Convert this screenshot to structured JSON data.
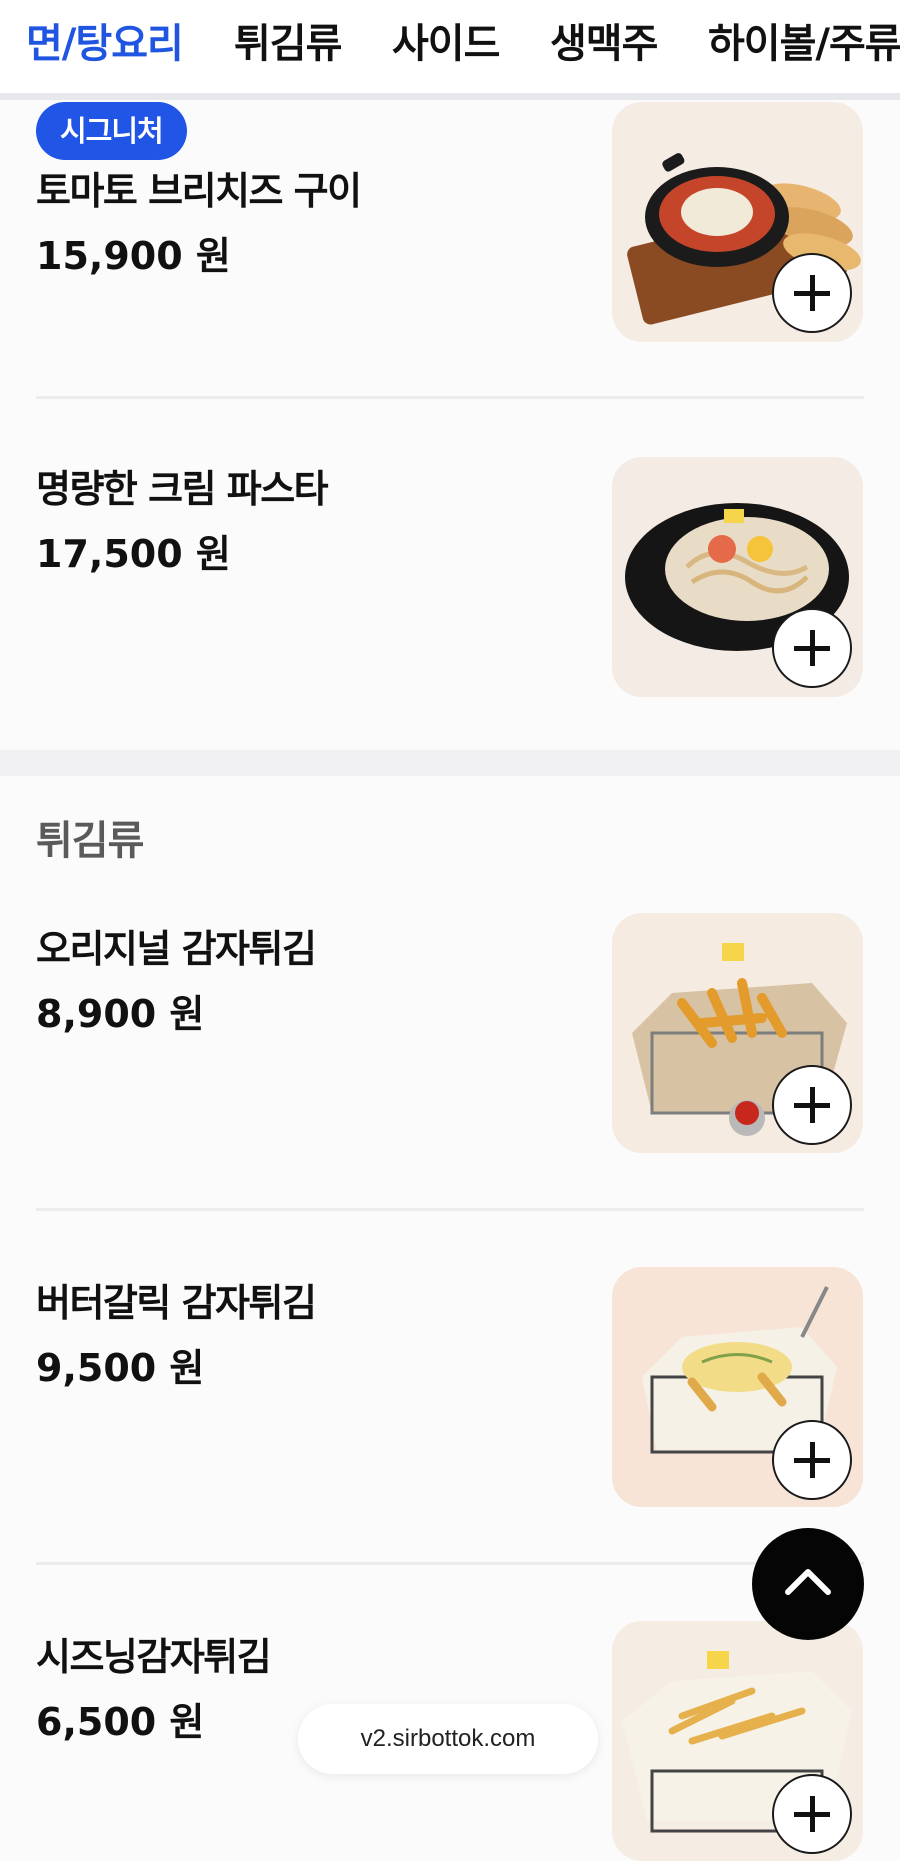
{
  "tabs": [
    {
      "label": "면/탕요리",
      "active": true
    },
    {
      "label": "튀김류",
      "active": false
    },
    {
      "label": "사이드",
      "active": false
    },
    {
      "label": "생맥주",
      "active": false
    },
    {
      "label": "하이볼/주류",
      "active": false
    }
  ],
  "sections": [
    {
      "items": [
        {
          "badge": "시그니처",
          "name": "토마토 브리치즈 구이",
          "price": "15,900 원",
          "image_icon": "brie-cheese-tomato-dish"
        },
        {
          "name": "명량한 크림 파스타",
          "price": "17,500 원",
          "image_icon": "cream-pasta-dish"
        }
      ]
    },
    {
      "title": "튀김류",
      "items": [
        {
          "name": "오리지널 감자튀김",
          "price": "8,900 원",
          "image_icon": "french-fries-basket"
        },
        {
          "name": "버터갈릭 감자튀김",
          "price": "9,500 원",
          "image_icon": "garlic-butter-fries-basket"
        },
        {
          "name": "시즈닝감자튀김",
          "price": "6,500 원",
          "image_icon": "seasoned-fries-basket"
        }
      ]
    }
  ],
  "footer": {
    "url": "v2.sirbottok.com"
  },
  "colors": {
    "accent": "#1f55e0",
    "badge": "#2055e6",
    "text": "#111111",
    "section_title": "#5a5a5a"
  }
}
